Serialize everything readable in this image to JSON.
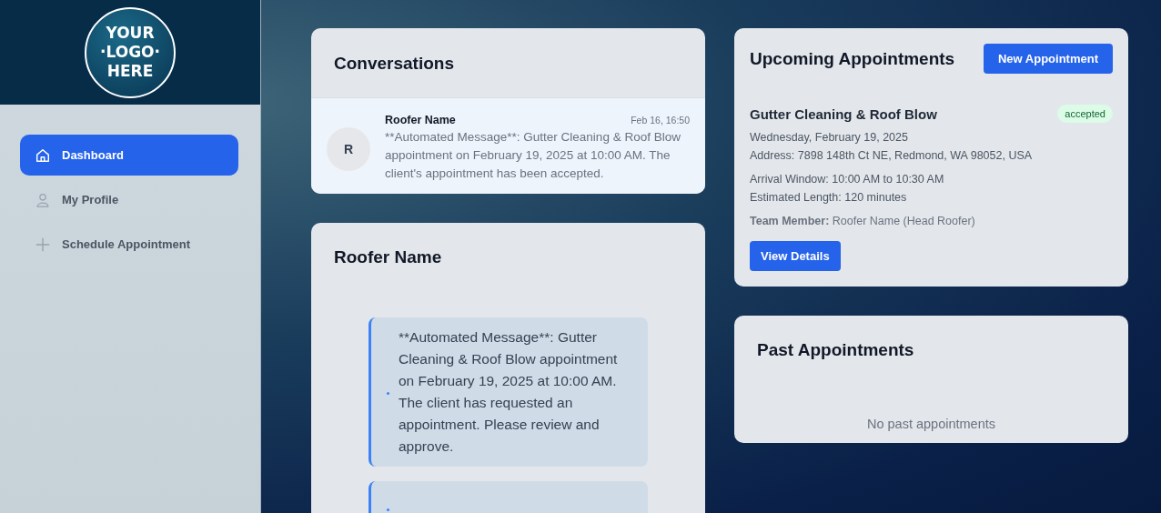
{
  "sidebar": {
    "logo": [
      "YOUR",
      "·LOGO·",
      "HERE"
    ],
    "items": [
      {
        "label": "Dashboard",
        "kind": "home",
        "selected": true
      },
      {
        "label": "My Profile",
        "kind": "person",
        "selected": false
      },
      {
        "label": "Schedule Appointment",
        "kind": "plus",
        "selected": false
      }
    ]
  },
  "conversations": {
    "title": "Conversations",
    "items": [
      {
        "initial": "R",
        "name": "Roofer Name",
        "time": "Feb 16, 16:50",
        "preview": "**Automated Message**: Gutter Cleaning & Roof Blow appointment on February 19, 2025 at 10:00 AM. The client's appointment has been accepted.",
        "selected": true
      }
    ]
  },
  "chat": {
    "title": "Roofer Name",
    "messages": [
      {
        "text": "**Automated Message**: Gutter Cleaning & Roof Blow appointment on February 19, 2025 at 10:00 AM. The client has requested an appointment. Please review and approve.",
        "partial": false
      },
      {
        "partial": true
      }
    ]
  },
  "upcoming": {
    "title": "Upcoming Appointments",
    "new_button": "New Appointment",
    "appointments": [
      {
        "title": "Gutter Cleaning & Roof Blow",
        "status": "accepted",
        "date": "Wednesday, February 19, 2025",
        "address": "Address: 7898 148th Ct NE, Redmond, WA 98052, USA",
        "arrival": "Arrival Window: 10:00 AM to 10:30 AM",
        "length": "Estimated Length: 120 minutes",
        "team": "**Team Member:** Roofer Name (Head Roofer)",
        "button": "View Details"
      }
    ]
  },
  "past": {
    "title": "Past Appointments",
    "empty": "No past appointments"
  }
}
